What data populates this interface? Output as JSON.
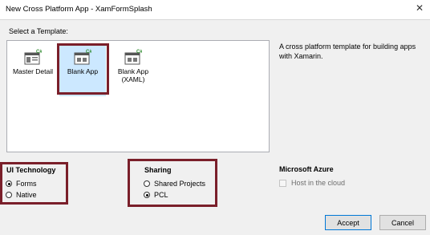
{
  "window": {
    "title": "New Cross Platform App - XamFormSplash",
    "close_glyph": "✕"
  },
  "templates": {
    "label": "Select a Template:",
    "items": [
      {
        "label": "Master Detail",
        "icon": "master-detail-template-icon",
        "selected": false
      },
      {
        "label": "Blank App",
        "icon": "blank-app-template-icon",
        "selected": true
      },
      {
        "label": "Blank App (XAML)",
        "icon": "blank-app-xaml-template-icon",
        "selected": false
      }
    ]
  },
  "description": "A cross platform template for building apps with Xamarin.",
  "ui_technology": {
    "title": "UI Technology",
    "options": [
      {
        "label": "Forms",
        "checked": true
      },
      {
        "label": "Native",
        "checked": false
      }
    ]
  },
  "sharing": {
    "title": "Sharing",
    "options": [
      {
        "label": "Shared Projects",
        "checked": false
      },
      {
        "label": "PCL",
        "checked": true
      }
    ]
  },
  "azure": {
    "title": "Microsoft Azure",
    "host_label": "Host in the cloud",
    "host_checked": false
  },
  "buttons": {
    "accept": "Accept",
    "cancel": "Cancel"
  },
  "colors": {
    "highlight_box": "#7a1f2a",
    "selection_bg": "#cce8ff",
    "accent": "#0078d7"
  }
}
